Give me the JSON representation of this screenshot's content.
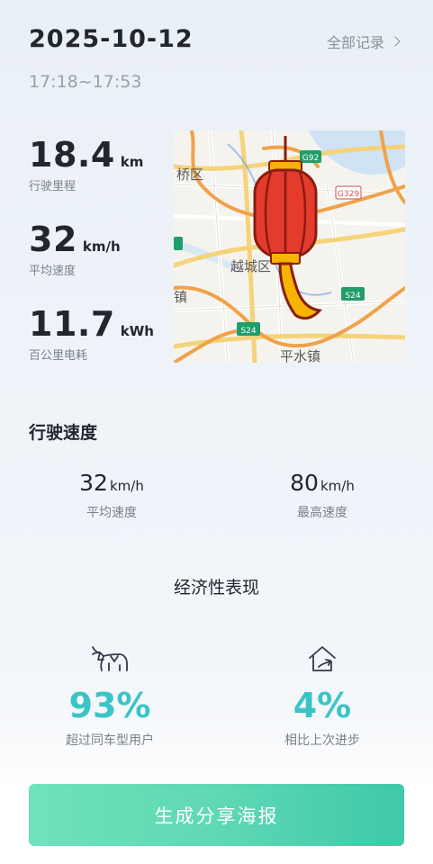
{
  "header": {
    "date": "2025-10-12",
    "records_label": "全部记录",
    "time_range": "17:18~17:53"
  },
  "stats": {
    "distance": {
      "value": "18.4",
      "unit": "km",
      "label": "行驶里程"
    },
    "avg_speed": {
      "value": "32",
      "unit": "km/h",
      "label": "平均速度"
    },
    "consumption": {
      "value": "11.7",
      "unit": "kWh",
      "label": "百公里电耗"
    }
  },
  "map": {
    "labels": {
      "district_left": "桥区",
      "district_center": "越城区",
      "town_left": "镇",
      "town_bottom": "平水镇"
    },
    "road_badges": {
      "g92": "G92",
      "g329": "G329",
      "s24_right": "S24",
      "s24_bottom": "S24"
    },
    "overlay_icon": "red-lantern-icon"
  },
  "driving_speed": {
    "title": "行驶速度",
    "average": {
      "value": "32",
      "unit": "km/h",
      "label": "平均速度"
    },
    "max": {
      "value": "80",
      "unit": "km/h",
      "label": "最高速度"
    }
  },
  "economy": {
    "title": "经济性表现",
    "beat_users": {
      "percent": "93%",
      "label": "超过同车型用户",
      "icon": "ox-icon"
    },
    "improvement": {
      "percent": "4%",
      "label": "相比上次进步",
      "icon": "house-arrow-icon"
    },
    "accent_color": "#3bc4c6"
  },
  "actions": {
    "share_label": "生成分享海报"
  }
}
